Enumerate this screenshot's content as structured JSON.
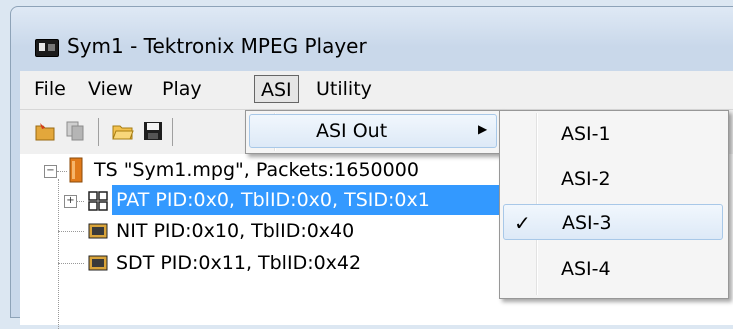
{
  "window": {
    "title": "Sym1 - Tektronix MPEG Player"
  },
  "menubar": {
    "items": [
      {
        "label": "File"
      },
      {
        "label": "View"
      },
      {
        "label": "Play"
      },
      {
        "label": "ASI"
      },
      {
        "label": "Utility"
      }
    ]
  },
  "toolbar": {
    "icons": [
      "open-stream-icon",
      "copy-icon",
      "open-folder-icon",
      "save-icon"
    ]
  },
  "tree": {
    "root": {
      "label": "TS \"Sym1.mpg\", Packets:1650000",
      "icon": "ts-file-icon"
    },
    "children": [
      {
        "label": "PAT PID:0x0, TblID:0x0, TSID:0x1",
        "icon": "pat-table-icon",
        "selected": true
      },
      {
        "label": "NIT PID:0x10, TblID:0x40",
        "icon": "table-icon"
      },
      {
        "label": "SDT PID:0x11, TblID:0x42",
        "icon": "table-icon"
      }
    ]
  },
  "asi_menu": {
    "item": {
      "label": "ASI Out",
      "arrow": "▶"
    }
  },
  "asi_out_submenu": {
    "items": [
      {
        "label": "ASI-1",
        "checked": false
      },
      {
        "label": "ASI-2",
        "checked": false
      },
      {
        "label": "ASI-3",
        "checked": true
      },
      {
        "label": "ASI-4",
        "checked": false
      }
    ],
    "check_glyph": "✓"
  },
  "colors": {
    "selection": "#3399ff",
    "menubar": "#f0f0f0",
    "menu_hover": "#dde9f7"
  }
}
